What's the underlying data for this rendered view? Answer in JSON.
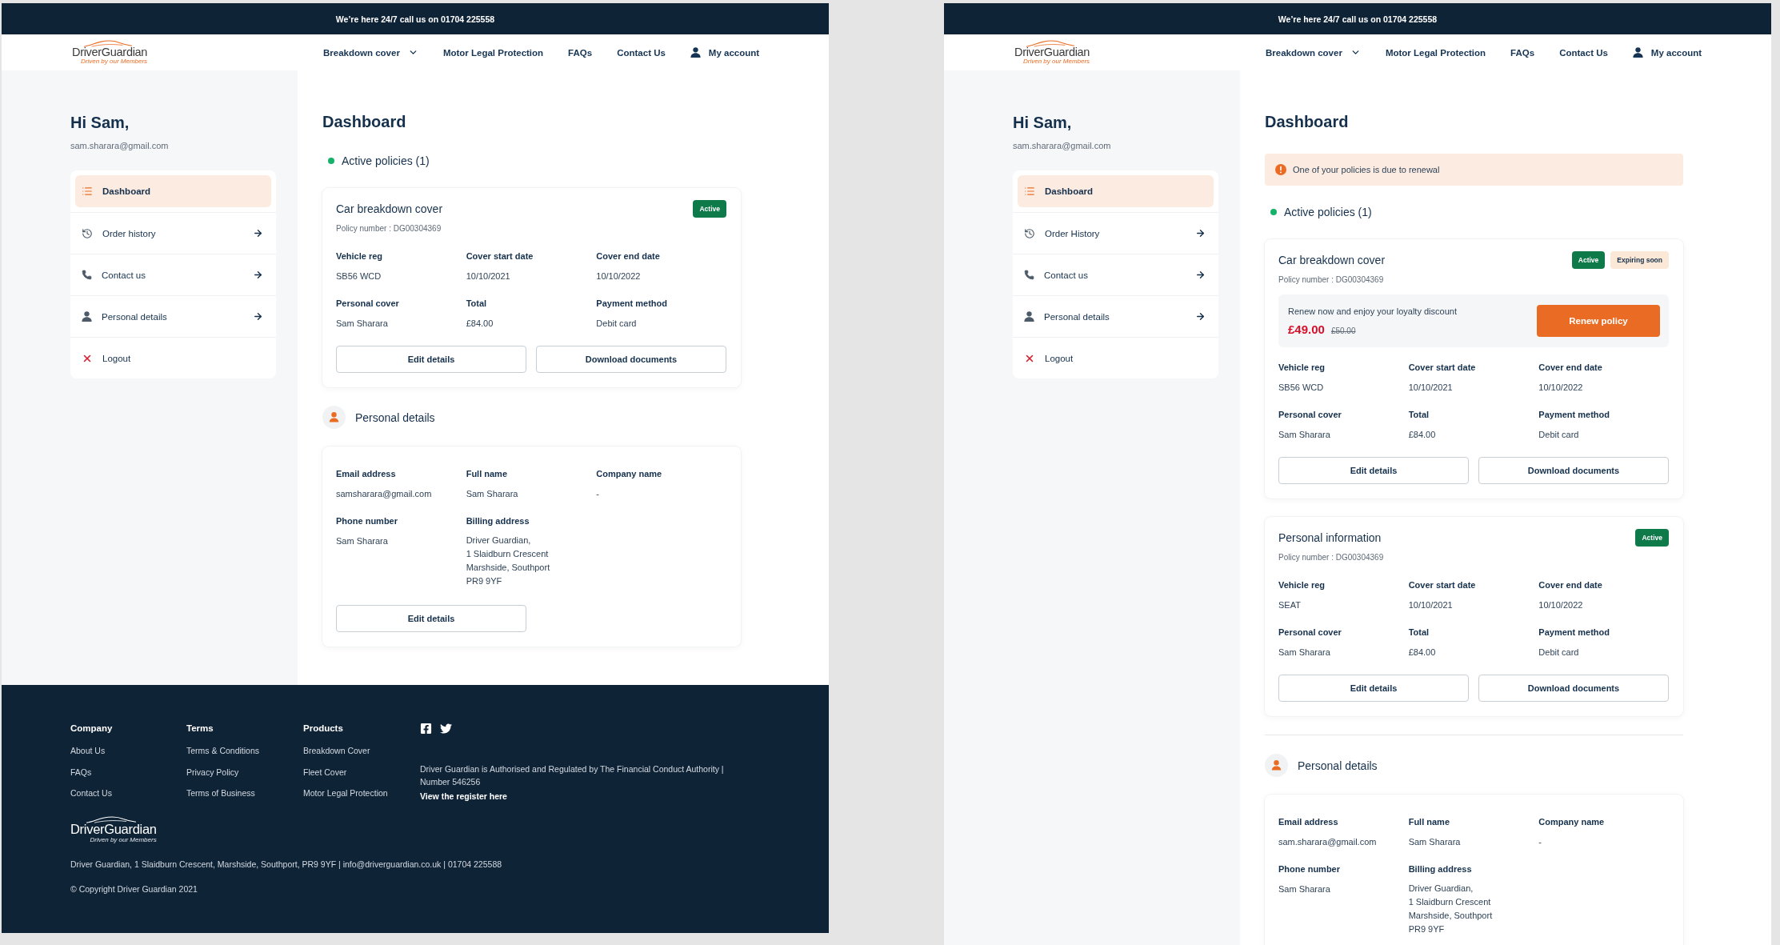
{
  "frames": [
    {
      "top_bar": {
        "text": "We’re here 24/7 call us on 01704 225558"
      },
      "header": {
        "logo": {
          "name": "DriverGuardian",
          "tagline": "Driven by our Members"
        },
        "nav": [
          {
            "label": "Breakdown cover",
            "kind": "dropdown"
          },
          {
            "label": "Motor Legal Protection",
            "kind": "link"
          },
          {
            "label": "FAQs",
            "kind": "link"
          },
          {
            "label": "Contact Us",
            "kind": "link"
          },
          {
            "label": "My account",
            "kind": "account"
          }
        ]
      },
      "sidebar": {
        "greeting": "Hi Sam,",
        "email": "sam.sharara@gmail.com",
        "menu": [
          {
            "label": "Dashboard",
            "kind": "dashboard",
            "selected": true
          },
          {
            "label": "Order history",
            "kind": "history",
            "selected": false
          },
          {
            "label": "Contact us",
            "kind": "contact",
            "selected": false
          },
          {
            "label": "Personal details",
            "kind": "profile",
            "selected": false
          },
          {
            "label": "Logout",
            "kind": "logout",
            "selected": false
          }
        ]
      },
      "main": {
        "title": "Dashboard",
        "policies_heading": "Active policies (1)",
        "policies": [
          {
            "title": "Car breakdown cover",
            "policy_number": "Policy number : DG00304369",
            "badges": [
              {
                "label": "Active",
                "kind": "active"
              }
            ],
            "fields": [
              {
                "label": "Vehicle reg",
                "value": "SB56 WCD"
              },
              {
                "label": "Cover start date",
                "value": "10/10/2021"
              },
              {
                "label": "Cover end date",
                "value": "10/10/2022"
              },
              {
                "label": "Personal cover",
                "value": "Sam Sharara"
              },
              {
                "label": "Total",
                "value": "£84.00"
              },
              {
                "label": "Payment method",
                "value": "Debit card"
              }
            ],
            "buttons": [
              "Edit details",
              "Download documents"
            ]
          }
        ],
        "personal_details": {
          "title": "Personal details",
          "divider_above": false,
          "fields": [
            {
              "label": "Email address",
              "value": "samsharara@gmail.com"
            },
            {
              "label": "Full name",
              "value": "Sam Sharara"
            },
            {
              "label": "Company name",
              "value": "-"
            },
            {
              "label": "Phone number",
              "value": "Sam Sharara"
            },
            {
              "label": "Billing address",
              "lines": [
                "Driver Guardian,",
                "1 Slaidburn Crescent",
                "Marshside, Southport",
                "PR9 9YF"
              ]
            }
          ],
          "buttons": [
            "Edit details"
          ]
        }
      },
      "footer": {
        "columns": [
          {
            "heading": "Company",
            "links": [
              "About Us",
              "FAQs",
              "Contact Us"
            ]
          },
          {
            "heading": "Terms",
            "links": [
              "Terms & Conditions",
              "Privacy Policy",
              "Terms of Business"
            ]
          },
          {
            "heading": "Products",
            "links": [
              "Breakdown Cover",
              "Fleet Cover",
              "Motor Legal Protection"
            ]
          }
        ],
        "regulation": "Driver Guardian is Authorised and Regulated by The Financial Conduct Authority | Number 546256",
        "register_link": "View the register here",
        "logo": {
          "name": "DriverGuardian",
          "tagline": "Driven by our Members"
        },
        "contact_line": "Driver Guardian, 1 Slaidburn Crescent, Marshside, Southport, PR9 9YF | info@driverguardian.co.uk | 01704 225588",
        "copyright": "© Copyright Driver Guardian 2021"
      }
    },
    {
      "top_bar": {
        "text": "We’re here 24/7 call us on 01704 225558"
      },
      "header": {
        "logo": {
          "name": "DriverGuardian",
          "tagline": "Driven by our Members"
        },
        "nav": [
          {
            "label": "Breakdown cover",
            "kind": "dropdown"
          },
          {
            "label": "Motor Legal Protection",
            "kind": "link"
          },
          {
            "label": "FAQs",
            "kind": "link"
          },
          {
            "label": "Contact Us",
            "kind": "link"
          },
          {
            "label": "My account",
            "kind": "account"
          }
        ]
      },
      "sidebar": {
        "greeting": "Hi Sam,",
        "email": "sam.sharara@gmail.com",
        "menu": [
          {
            "label": "Dashboard",
            "kind": "dashboard",
            "selected": true
          },
          {
            "label": "Order History",
            "kind": "history",
            "selected": false
          },
          {
            "label": "Contact us",
            "kind": "contact",
            "selected": false
          },
          {
            "label": "Personal details",
            "kind": "profile",
            "selected": false
          },
          {
            "label": "Logout",
            "kind": "logout",
            "selected": false
          }
        ]
      },
      "main": {
        "title": "Dashboard",
        "alert": {
          "text": "One of your policies is due to renewal"
        },
        "policies_heading": "Active policies (1)",
        "policies": [
          {
            "title": "Car breakdown cover",
            "policy_number": "Policy number : DG00304369",
            "badges": [
              {
                "label": "Active",
                "kind": "active"
              },
              {
                "label": "Expiring soon",
                "kind": "expiring"
              }
            ],
            "renewal": {
              "text": "Renew now and enjoy your loyalty discount",
              "price": "£49.00",
              "old_price": "£50.00",
              "button": "Renew policy"
            },
            "fields": [
              {
                "label": "Vehicle reg",
                "value": "SB56 WCD"
              },
              {
                "label": "Cover start date",
                "value": "10/10/2021"
              },
              {
                "label": "Cover end date",
                "value": "10/10/2022"
              },
              {
                "label": "Personal cover",
                "value": "Sam Sharara"
              },
              {
                "label": "Total",
                "value": "£84.00"
              },
              {
                "label": "Payment method",
                "value": "Debit card"
              }
            ],
            "buttons": [
              "Edit details",
              "Download documents"
            ]
          },
          {
            "title": "Personal information",
            "policy_number": "Policy number : DG00304369",
            "badges": [
              {
                "label": "Active",
                "kind": "active"
              }
            ],
            "fields": [
              {
                "label": "Vehicle reg",
                "value": "SEAT"
              },
              {
                "label": "Cover start date",
                "value": "10/10/2021"
              },
              {
                "label": "Cover end date",
                "value": "10/10/2022"
              },
              {
                "label": "Personal cover",
                "value": "Sam Sharara"
              },
              {
                "label": "Total",
                "value": "£84.00"
              },
              {
                "label": "Payment method",
                "value": "Debit card"
              }
            ],
            "buttons": [
              "Edit details",
              "Download documents"
            ]
          }
        ],
        "personal_details": {
          "title": "Personal details",
          "divider_above": true,
          "fields": [
            {
              "label": "Email address",
              "value": "sam.sharara@gmail.com"
            },
            {
              "label": "Full name",
              "value": "Sam Sharara"
            },
            {
              "label": "Company name",
              "value": "-"
            },
            {
              "label": "Phone number",
              "value": "Sam Sharara"
            },
            {
              "label": "Billing address",
              "lines": [
                "Driver Guardian,",
                "1 Slaidburn Crescent",
                "Marshside, Southport",
                "PR9 9YF"
              ]
            }
          ]
        }
      }
    }
  ]
}
